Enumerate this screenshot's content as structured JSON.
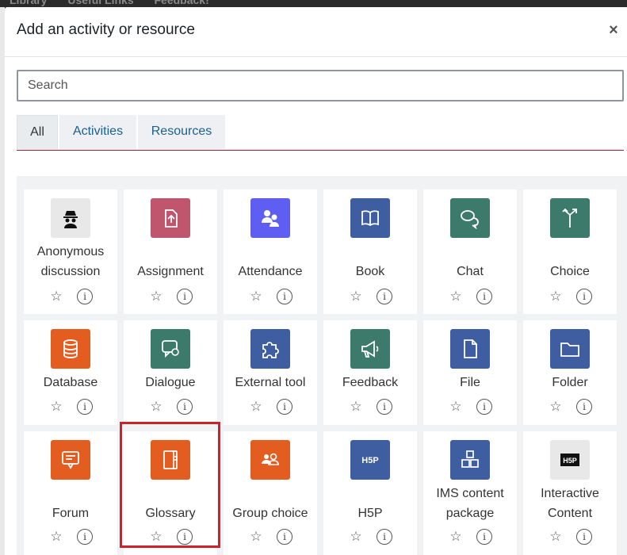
{
  "topbar": {
    "items": [
      "Library",
      "Useful Links",
      "Feedback!"
    ]
  },
  "modal": {
    "title": "Add an activity or resource",
    "close_label": "×",
    "search": {
      "placeholder": "Search",
      "value": ""
    },
    "tabs": [
      {
        "label": "All",
        "active": true
      },
      {
        "label": "Activities",
        "active": false
      },
      {
        "label": "Resources",
        "active": false
      }
    ]
  },
  "tile_actions": {
    "star": "☆",
    "info": "i"
  },
  "tiles": [
    {
      "label": "Anonymous discussion",
      "line1": "Anonymous",
      "line2": "discussion",
      "icon": "spy-icon",
      "color": "#e8e8e8"
    },
    {
      "label": "Assignment",
      "icon": "upload-icon",
      "color": "#c0556e"
    },
    {
      "label": "Attendance",
      "icon": "people-icon",
      "color": "#5e5ff2"
    },
    {
      "label": "Book",
      "icon": "book-icon",
      "color": "#3f5ea1"
    },
    {
      "label": "Chat",
      "icon": "chat-icon",
      "color": "#3c7a6b"
    },
    {
      "label": "Choice",
      "icon": "signpost-icon",
      "color": "#3c7a6b"
    },
    {
      "label": "Database",
      "icon": "database-icon",
      "color": "#e25d1f"
    },
    {
      "label": "Dialogue",
      "icon": "dialogue-icon",
      "color": "#3c7a6b"
    },
    {
      "label": "External tool",
      "icon": "puzzle-icon",
      "color": "#3f5ea1"
    },
    {
      "label": "Feedback",
      "icon": "megaphone-icon",
      "color": "#3c7a6b"
    },
    {
      "label": "File",
      "icon": "file-icon",
      "color": "#3f5ea1"
    },
    {
      "label": "Folder",
      "icon": "folder-icon",
      "color": "#3f5ea1"
    },
    {
      "label": "Forum",
      "icon": "forum-icon",
      "color": "#e25d1f"
    },
    {
      "label": "Glossary",
      "icon": "glossary-icon",
      "color": "#e25d1f"
    },
    {
      "label": "Group choice",
      "icon": "group-icon",
      "color": "#e25d1f"
    },
    {
      "label": "H5P",
      "icon": "h5p-icon",
      "color": "#3f5ea1"
    },
    {
      "label": "IMS content package",
      "line1": "IMS content",
      "line2": "package",
      "icon": "package-icon",
      "color": "#3f5ea1"
    },
    {
      "label": "Interactive Content",
      "line1": "Interactive",
      "line2": "Content",
      "icon": "h5p-dark-icon",
      "color": "#e8e8e8"
    }
  ],
  "colors": {
    "tab_underline": "#9b1c2e",
    "highlight": "#d11f2e",
    "link": "#1b5f8f"
  }
}
